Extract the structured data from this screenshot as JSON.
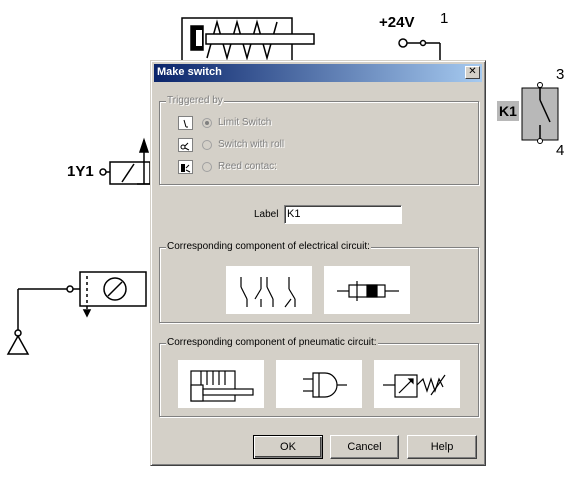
{
  "canvas": {
    "supply_label": "+24V",
    "node_1": "1",
    "node_3": "3",
    "node_4": "4",
    "relay_label": "K1",
    "solenoid_label": "1Y1"
  },
  "dialog": {
    "title": "Make switch",
    "close_glyph": "✕",
    "triggered_by": {
      "legend": "Triggered by",
      "options": [
        {
          "label": "Limit Switch",
          "checked": true,
          "icon": "limit-switch-symbol-icon"
        },
        {
          "label": "Switch with roll",
          "checked": false,
          "icon": "roller-switch-symbol-icon"
        },
        {
          "label": "Reed contac:",
          "checked": false,
          "icon": "reed-contact-symbol-icon"
        }
      ]
    },
    "label_field": {
      "caption": "Label",
      "value": "K1"
    },
    "electrical": {
      "legend": "Corresponding component of electrical circuit:",
      "tiles": [
        "switch-contacts-symbol",
        "relay-coil-symbol"
      ]
    },
    "pneumatic": {
      "legend": "Corresponding component of pneumatic circuit:",
      "tiles": [
        "cylinder-symbol",
        "and-valve-symbol",
        "solenoid-valve-symbol"
      ]
    },
    "buttons": {
      "ok": "OK",
      "cancel": "Cancel",
      "help": "Help"
    }
  },
  "colors": {
    "dialog_face": "#d4d0c8",
    "titlebar_start": "#0a246a",
    "titlebar_end": "#a6caf0",
    "relay_fill": "#b8b8b8"
  }
}
